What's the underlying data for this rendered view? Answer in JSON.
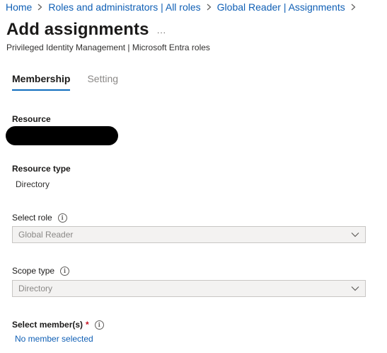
{
  "breadcrumb": {
    "items": [
      "Home",
      "Roles and administrators | All roles",
      "Global Reader | Assignments"
    ]
  },
  "header": {
    "title": "Add assignments",
    "more": "...",
    "subtitle": "Privileged Identity Management | Microsoft Entra roles"
  },
  "tabs": [
    {
      "label": "Membership",
      "active": true
    },
    {
      "label": "Setting",
      "active": false
    }
  ],
  "form": {
    "resource_label": "Resource",
    "resource_type_label": "Resource type",
    "resource_type_value": "Directory",
    "select_role_label": "Select role",
    "select_role_value": "Global Reader",
    "scope_type_label": "Scope type",
    "scope_type_value": "Directory",
    "select_members_label": "Select member(s)",
    "required_marker": "*",
    "select_members_link": "No member selected"
  },
  "colors": {
    "link": "#0f5fb5",
    "active_tab_underline": "#0f6cbd",
    "required": "#c50f1f",
    "disabled_field_bg": "#f3f2f1"
  }
}
